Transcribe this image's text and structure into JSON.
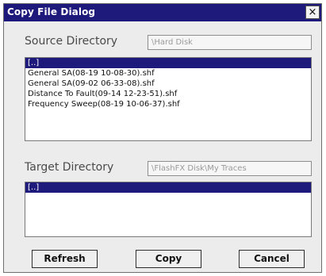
{
  "window": {
    "title": "Copy File Dialog",
    "close_glyph": "×",
    "close_icon": "close-icon"
  },
  "source": {
    "label": "Source Directory",
    "path": "\\Hard Disk",
    "items": [
      {
        "label": "[..]",
        "selected": true
      },
      {
        "label": "General SA(08-19 10-08-30).shf",
        "selected": false
      },
      {
        "label": "General SA(09-02 06-33-08).shf",
        "selected": false
      },
      {
        "label": "Distance To Fault(09-14 12-23-51).shf",
        "selected": false
      },
      {
        "label": "Frequency Sweep(08-19 10-06-37).shf",
        "selected": false
      }
    ]
  },
  "target": {
    "label": "Target Directory",
    "path": "\\FlashFX Disk\\My Traces",
    "items": [
      {
        "label": "[..]",
        "selected": true
      }
    ]
  },
  "buttons": {
    "refresh": "Refresh",
    "copy": "Copy",
    "cancel": "Cancel"
  },
  "colors": {
    "titlebar": "#1e1a7c",
    "selection": "#1e1a7c",
    "dialog_bg": "#ececec"
  }
}
